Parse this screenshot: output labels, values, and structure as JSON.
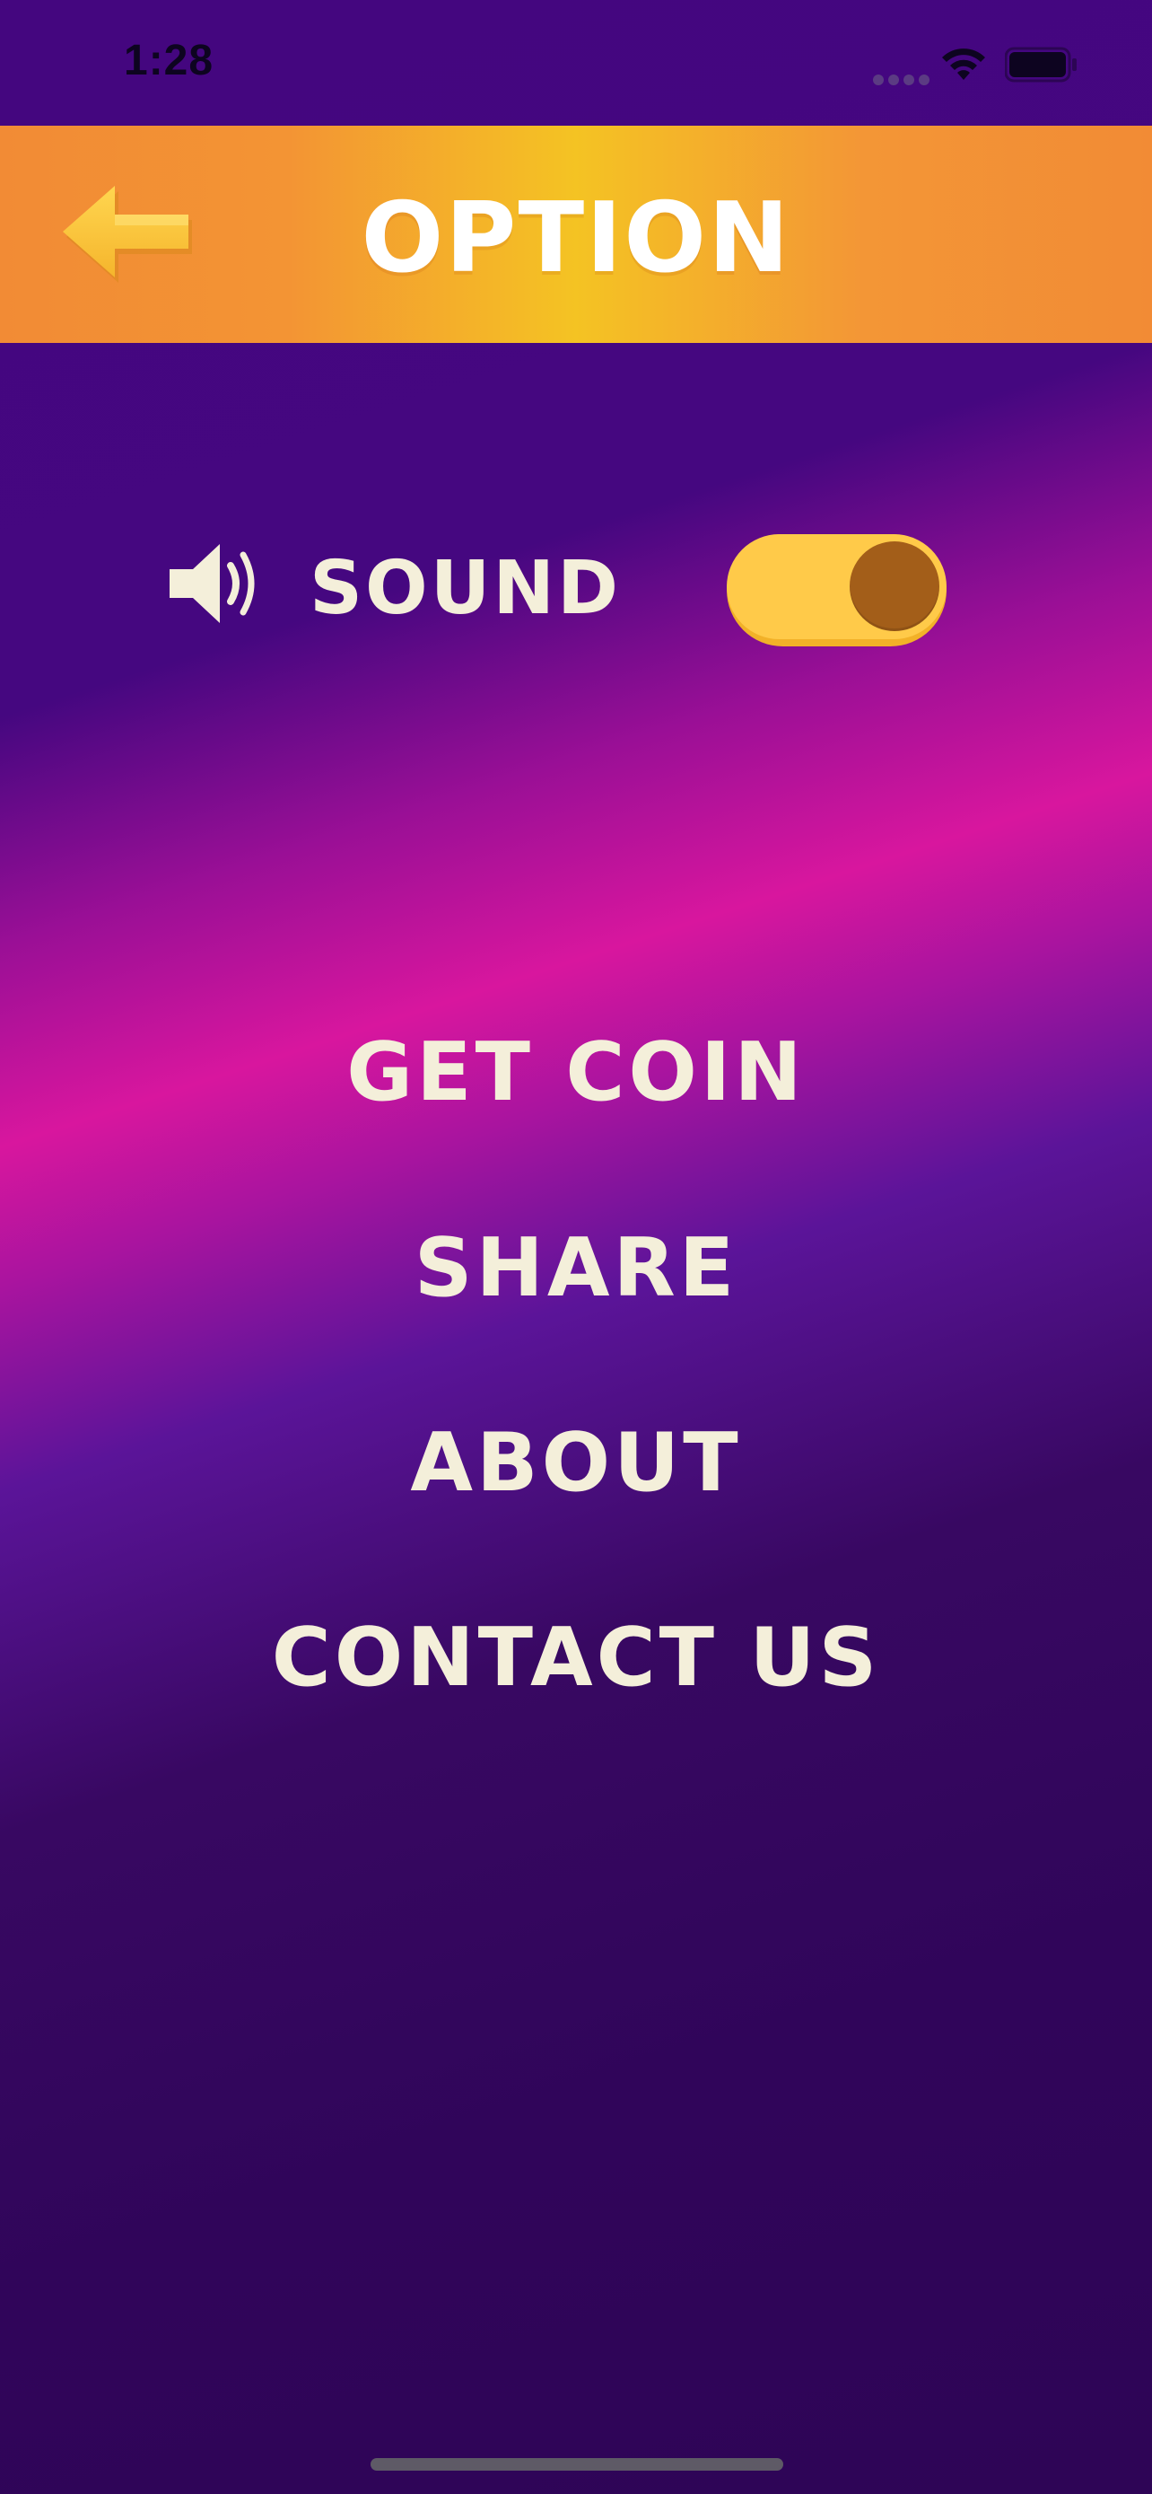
{
  "status_bar": {
    "time": "1:28",
    "signal_icon": "cellular-dots-icon",
    "wifi_icon": "wifi-icon",
    "battery_icon": "battery-icon"
  },
  "header": {
    "title": "OPTION",
    "back_icon": "arrow-left-icon",
    "gradient_colors": [
      "#f28b35",
      "#f4c323",
      "#f28b35"
    ]
  },
  "settings": {
    "sound": {
      "label": "SOUND",
      "icon": "speaker-icon",
      "enabled": true,
      "toggle_color": "#ffca49",
      "knob_color": "#a35e19"
    }
  },
  "menu": {
    "items": [
      {
        "label": "GET COIN"
      },
      {
        "label": "SHARE"
      },
      {
        "label": "ABOUT"
      },
      {
        "label": "CONTACT US"
      }
    ]
  },
  "colors": {
    "text": "#f4efda",
    "background_top": "#44067f",
    "background_accent": "#d8169e",
    "background_bottom": "#2e0556"
  }
}
